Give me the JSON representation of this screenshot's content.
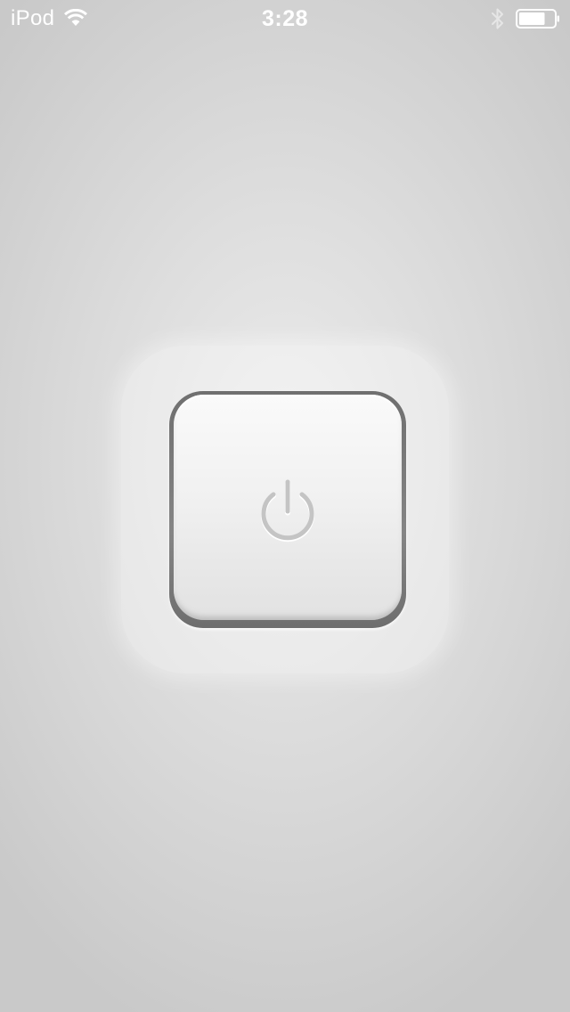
{
  "status_bar": {
    "carrier": "iPod",
    "time": "3:28",
    "wifi_icon": "wifi-icon",
    "bluetooth_icon": "bluetooth-icon",
    "battery_icon": "battery-icon",
    "battery_level": 0.75,
    "text_color": "#ffffff"
  },
  "main": {
    "power_button": {
      "icon": "power-icon",
      "icon_color": "#c4c4c4",
      "face_color": "#f2f2f2"
    }
  },
  "background": {
    "center_color": "#ebebeb",
    "edge_color": "#c9c9c9"
  }
}
